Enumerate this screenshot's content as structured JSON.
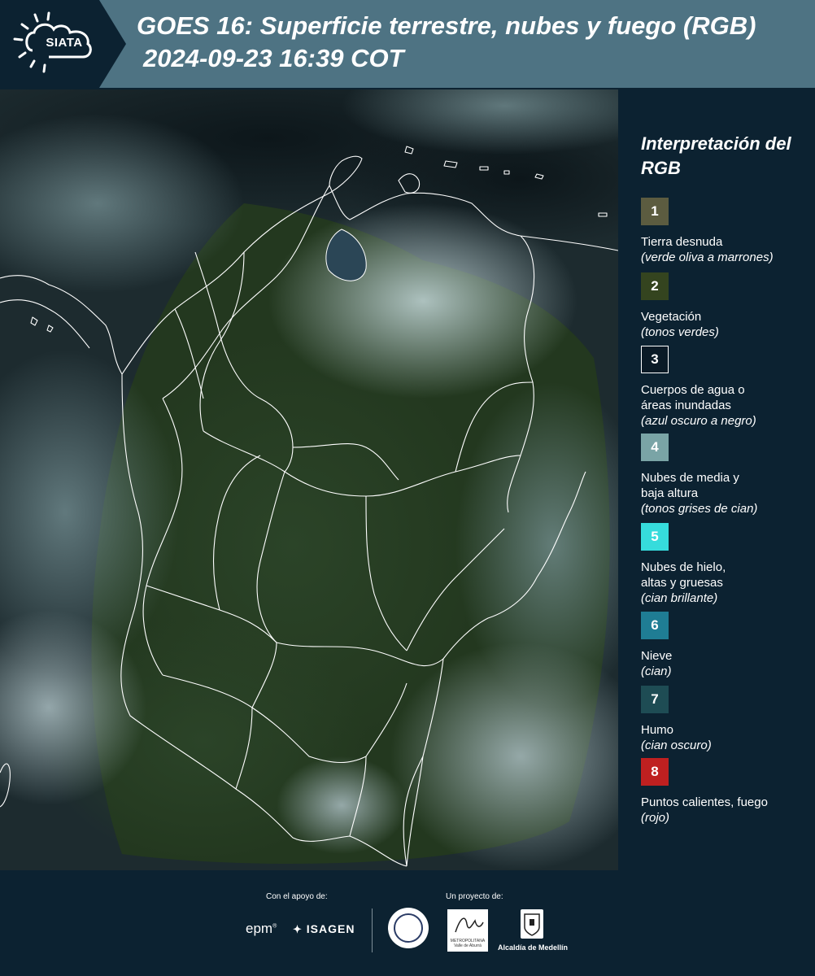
{
  "header": {
    "logo_text": "SIATA",
    "title": "GOES 16: Superficie terrestre, nubes y fuego (RGB)",
    "timestamp": "2024-09-23 16:39 COT",
    "background_color": "#4e7383",
    "logo_panel_color": "#0c2231"
  },
  "map": {
    "description_icon": "satellite-rgb-map",
    "boundary_color": "#ffffff"
  },
  "legend": {
    "title": "Interpretación del RGB",
    "items": [
      {
        "number": "1",
        "label": "Tierra desnuda",
        "desc": "(verde oliva a marrones)",
        "color": "#5c5c40"
      },
      {
        "number": "2",
        "label": "Vegetación",
        "desc": "(tonos verdes)",
        "color": "#34441f"
      },
      {
        "number": "3",
        "label": "Cuerpos de agua o áreas inundadas",
        "desc": "(azul oscuro a negro)",
        "color": "#0a1a26"
      },
      {
        "number": "4",
        "label": "Nubes de media y baja altura",
        "desc": "(tonos grises de cian)",
        "color": "#7aa4a6"
      },
      {
        "number": "5",
        "label": "Nubes de hielo, altas y gruesas",
        "desc": "(cian brillante)",
        "color": "#36dcdc"
      },
      {
        "number": "6",
        "label": "Nieve",
        "desc": "(cian)",
        "color": "#1f7d94"
      },
      {
        "number": "7",
        "label": "Humo",
        "desc": "(cian oscuro)",
        "color": "#1e4c54"
      },
      {
        "number": "8",
        "label": "Puntos calientes, fuego",
        "desc": "(rojo)",
        "color": "#bf2020"
      }
    ]
  },
  "footer": {
    "support_label": "Con el apoyo de:",
    "project_label": "Un proyecto de:",
    "sponsor_epm": "epm",
    "sponsor_isagen": "ISAGEN",
    "area_text": "METROPOLITANA Valle de Aburrá",
    "medellin_text": "Alcaldía de Medellín"
  }
}
